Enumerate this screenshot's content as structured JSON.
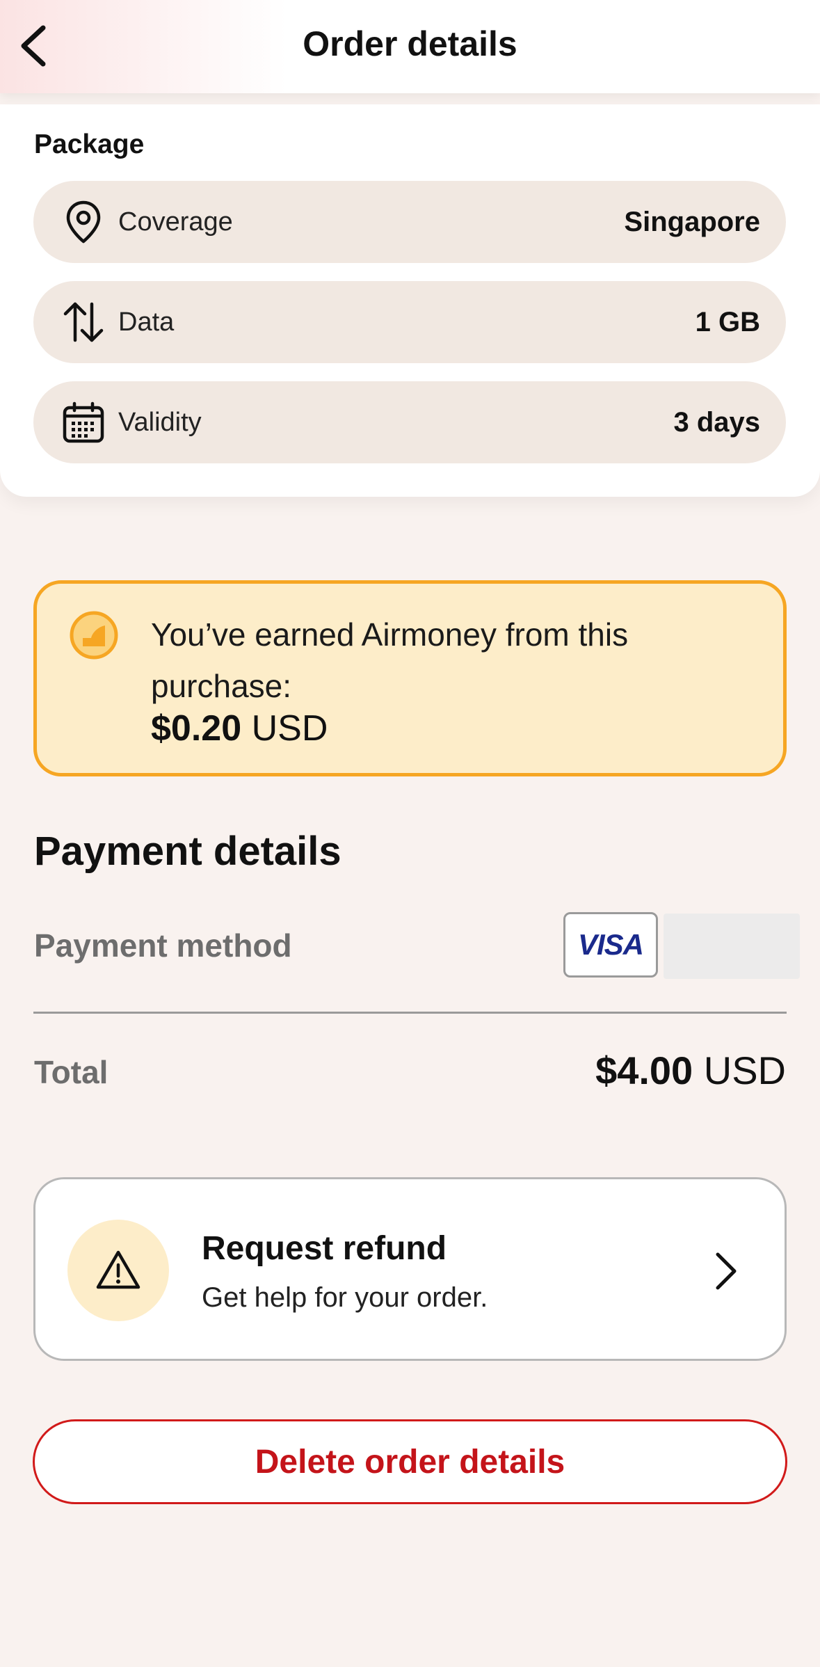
{
  "header": {
    "title": "Order details"
  },
  "package": {
    "title": "Package",
    "rows": [
      {
        "label": "Coverage",
        "value": "Singapore",
        "icon": "location-pin-icon"
      },
      {
        "label": "Data",
        "value": "1 GB",
        "icon": "up-down-arrows-icon"
      },
      {
        "label": "Validity",
        "value": "3 days",
        "icon": "calendar-icon"
      }
    ]
  },
  "airmoney": {
    "message": "You’ve earned Airmoney from this purchase:",
    "amount": "$0.20",
    "currency": "USD",
    "icon": "airmoney-coin-icon"
  },
  "payment": {
    "title": "Payment details",
    "method_label": "Payment method",
    "card_brand": "VISA",
    "total_label": "Total",
    "total_amount": "$4.00",
    "total_currency": "USD"
  },
  "refund": {
    "title": "Request refund",
    "subtitle": "Get help for your order.",
    "icon": "warning-triangle-icon"
  },
  "actions": {
    "delete_label": "Delete order details"
  },
  "colors": {
    "accent_red": "#c4141a",
    "airmoney_border": "#f6a623",
    "airmoney_bg": "#fdedc9",
    "row_bg": "#f1e8e1",
    "page_bg": "#f9f2ef"
  }
}
